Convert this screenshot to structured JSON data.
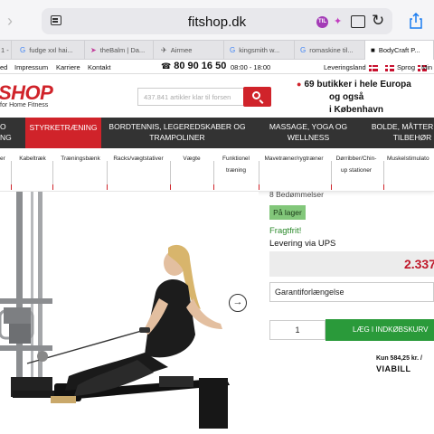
{
  "browser": {
    "url": "fitshop.dk",
    "ext1_label": "TIL",
    "tabs": [
      {
        "label": "1 -"
      },
      {
        "label": "fudge xxl hai..."
      },
      {
        "label": "theBalm | Da..."
      },
      {
        "label": "Airmee"
      },
      {
        "label": "kingsmith w..."
      },
      {
        "label": "romaskine til..."
      },
      {
        "label": "BodyCraft P..."
      }
    ]
  },
  "utility": {
    "links": [
      "ed",
      "Impressum",
      "Karriere",
      "Kontakt"
    ],
    "phone": "80 90 16 50",
    "hours": "08:00 - 18:00",
    "country": "Leveringsland",
    "language": "Sprog",
    "more": "Min"
  },
  "header": {
    "logo": "SHOP",
    "logo_sub": "for Home Fitness",
    "search_placeholder": "437.841 artikler klar til forsen",
    "promo_line1": "69 butikker i hele Europa",
    "promo_line2": "og også",
    "promo_line3": "i København"
  },
  "nav": {
    "items": [
      {
        "l1": "O",
        "l2": "NG"
      },
      {
        "l1": "STYRKETRÆNING",
        "l2": ""
      },
      {
        "l1": "BORDTENNIS, LEGEREDSKABER OG",
        "l2": "TRAMPOLINER"
      },
      {
        "l1": "MASSAGE, YOGA OG",
        "l2": "WELLNESS"
      },
      {
        "l1": "BOLDE, MÅTTER Y",
        "l2": "TILBEHØR"
      }
    ]
  },
  "subnav": {
    "items": [
      {
        "l1": "er",
        "l2": ""
      },
      {
        "l1": "Kabeltræk",
        "l2": ""
      },
      {
        "l1": "Træningsbænk",
        "l2": ""
      },
      {
        "l1": "Racks/vægtstativer",
        "l2": ""
      },
      {
        "l1": "Vægte",
        "l2": ""
      },
      {
        "l1": "Funktionel",
        "l2": "træning"
      },
      {
        "l1": "Mavetræner/rygtræner",
        "l2": ""
      },
      {
        "l1": "Dørribber/Chin-",
        "l2": "up stationer"
      },
      {
        "l1": "Muskelstimulato",
        "l2": ""
      }
    ]
  },
  "product": {
    "reviews": "8 Bedømmelser",
    "stock": "På lager",
    "free_shipping": "Fragtfrit!",
    "delivery": "Levering via UPS",
    "price": "2.337",
    "warranty": "Garantiforlængelse",
    "quantity": "1",
    "cart_button": "LÆG I INDKØBSKURV",
    "installment": "Kun 584,25 kr. /",
    "viabill": "VIABILL"
  }
}
